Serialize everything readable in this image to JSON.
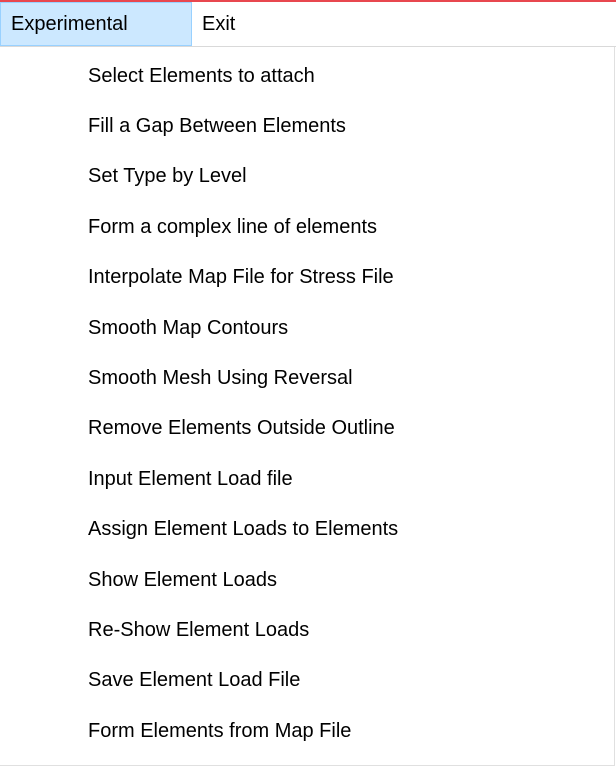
{
  "menubar": {
    "items": [
      {
        "label": "Experimental"
      },
      {
        "label": "Exit"
      }
    ]
  },
  "dropdown": {
    "items": [
      {
        "label": "Select Elements to attach"
      },
      {
        "label": "Fill a Gap Between Elements"
      },
      {
        "label": "Set Type by Level"
      },
      {
        "label": "Form a complex line of elements"
      },
      {
        "label": "Interpolate Map File for Stress File"
      },
      {
        "label": "Smooth Map Contours"
      },
      {
        "label": "Smooth Mesh Using Reversal"
      },
      {
        "label": "Remove Elements Outside Outline"
      },
      {
        "label": "Input Element Load file"
      },
      {
        "label": "Assign Element Loads to Elements"
      },
      {
        "label": "Show Element Loads"
      },
      {
        "label": "Re-Show Element Loads"
      },
      {
        "label": "Save Element Load File"
      },
      {
        "label": "Form Elements from Map File"
      }
    ]
  },
  "colors": {
    "active_menu_bg": "#cce8ff",
    "active_menu_border": "#99d1ff",
    "top_accent": "#e8474f"
  }
}
